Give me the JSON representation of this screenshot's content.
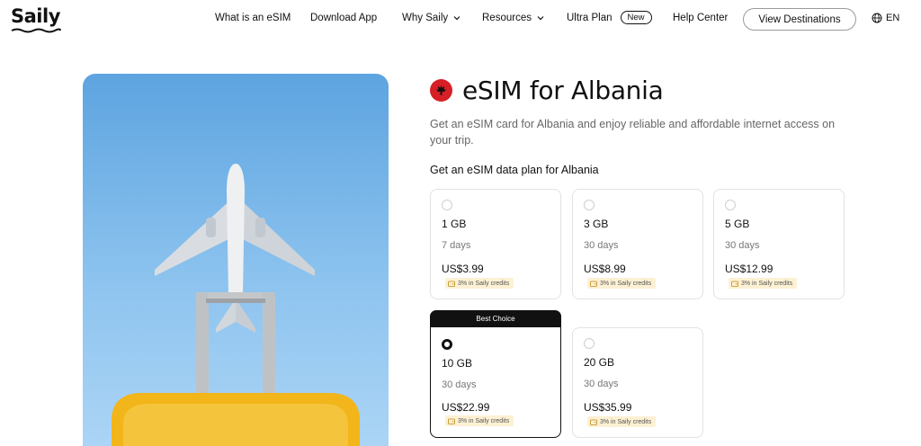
{
  "header": {
    "logo": "Saily",
    "nav": [
      {
        "label": "What is an eSIM",
        "dropdown": false
      },
      {
        "label": "Download App",
        "dropdown": false
      },
      {
        "label": "Why Saily",
        "dropdown": true
      },
      {
        "label": "Resources",
        "dropdown": true
      },
      {
        "label": "Ultra Plan",
        "badge": "New",
        "dropdown": false
      },
      {
        "label": "Help Center",
        "dropdown": false
      }
    ],
    "cta": "View Destinations",
    "language": "EN"
  },
  "hero": {
    "illustration": "airplane-over-yellow-suitcase",
    "sky_top": "#5da4e0",
    "sky_bottom": "#aed6f6",
    "suitcase_color": "#f2b51a"
  },
  "content": {
    "flag": "albania-flag",
    "title": "eSIM for Albania",
    "subtitle": "Get an eSIM card for Albania and enjoy reliable and affordable internet access on your trip.",
    "section_title": "Get an eSIM data plan for Albania"
  },
  "plans": [
    {
      "data": "1 GB",
      "days": "7 days",
      "price": "US$3.99",
      "credits": "3% in Saily credits",
      "selected": false,
      "best": false
    },
    {
      "data": "3 GB",
      "days": "30 days",
      "price": "US$8.99",
      "credits": "3% in Saily credits",
      "selected": false,
      "best": false
    },
    {
      "data": "5 GB",
      "days": "30 days",
      "price": "US$12.99",
      "credits": "3% in Saily credits",
      "selected": false,
      "best": false
    },
    {
      "data": "10 GB",
      "days": "30 days",
      "price": "US$22.99",
      "credits": "3% in Saily credits",
      "selected": true,
      "best": true,
      "banner": "Best Choice"
    },
    {
      "data": "20 GB",
      "days": "30 days",
      "price": "US$35.99",
      "credits": "3% in Saily credits",
      "selected": false,
      "best": false
    }
  ],
  "colors": {
    "accent": "#111111",
    "flag_red": "#d61f26",
    "credits_bg": "#fdf1d4"
  }
}
